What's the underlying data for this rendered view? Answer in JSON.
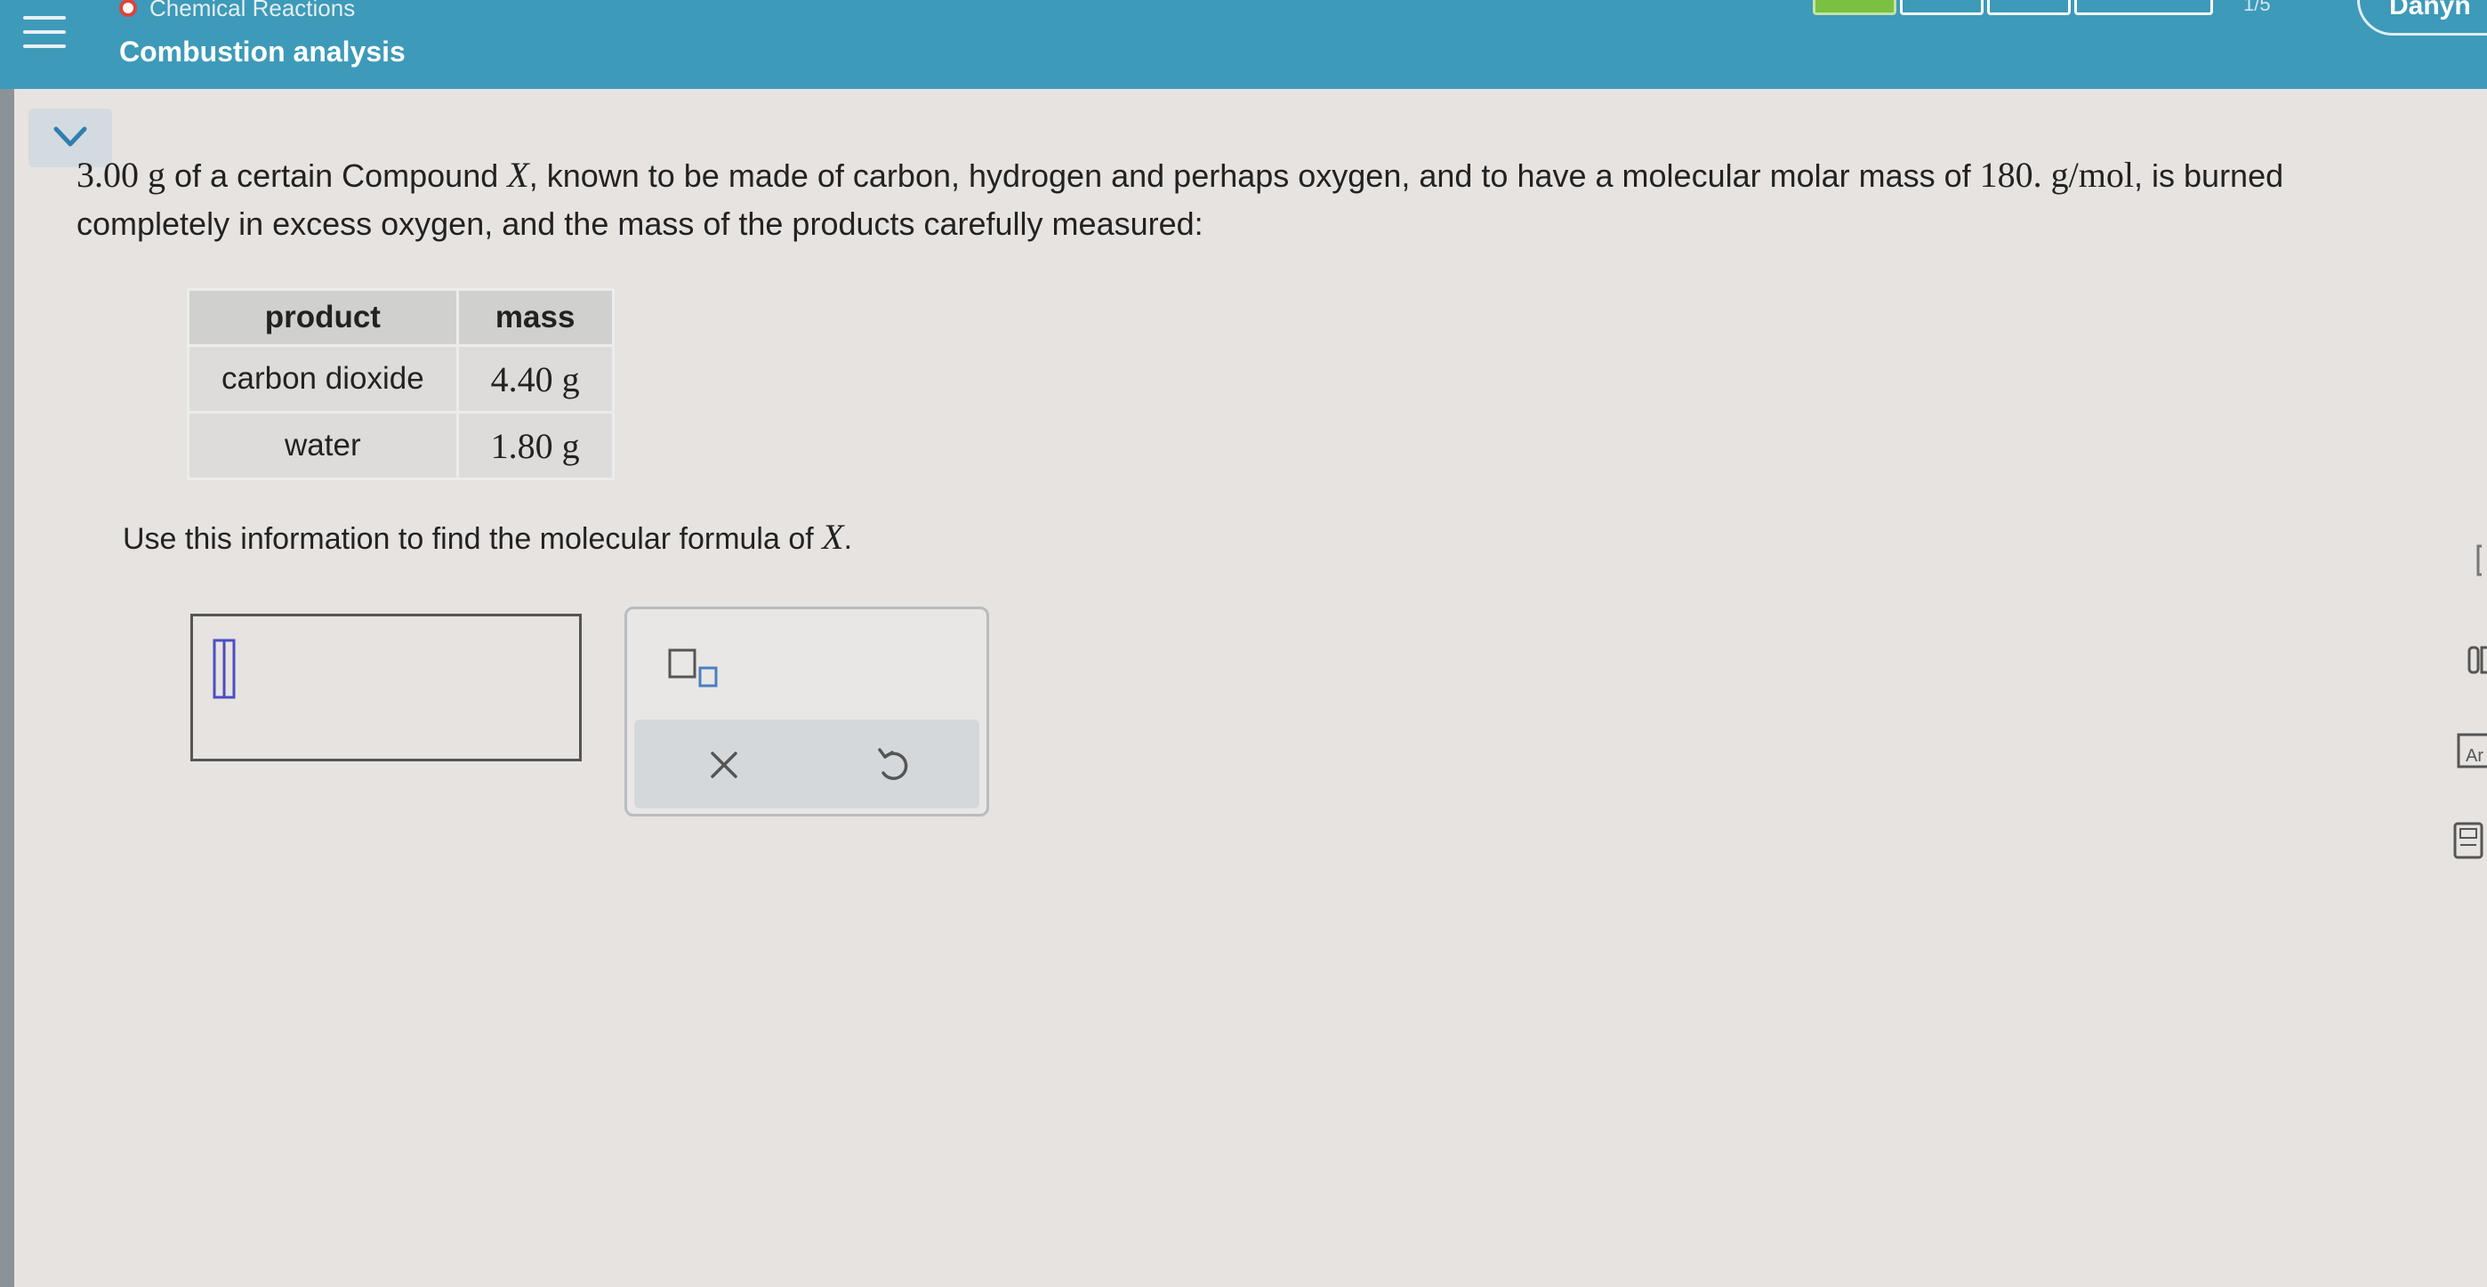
{
  "header": {
    "topic": "Chemical Reactions",
    "subtitle": "Combustion analysis",
    "progress_count": "1/5",
    "user_name": "Danyn"
  },
  "question": {
    "mass": "3.00",
    "unit_g": "g",
    "part1": " of a certain Compound ",
    "compound": "X",
    "part2": ", known to be made of carbon, hydrogen and perhaps oxygen, and to have a molecular molar mass of ",
    "molar_mass": "180.",
    "molar_unit": "g/mol",
    "part3": ", is burned completely in excess oxygen, and the mass of the products carefully measured:"
  },
  "table": {
    "headers": [
      "product",
      "mass"
    ],
    "rows": [
      {
        "product": "carbon dioxide",
        "mass": "4.40 g"
      },
      {
        "product": "water",
        "mass": "1.80 g"
      }
    ]
  },
  "instruction": {
    "text": "Use this information to find the molecular formula of ",
    "var": "X",
    "end": "."
  },
  "tools": {
    "clear_symbol": "×",
    "undo_symbol": "↺"
  },
  "colors": {
    "header": "#3d9ab9",
    "panel": "#e6e3e0",
    "accent_icon": "#4a4fc4",
    "progress_done": "#7ac142"
  },
  "icons": {
    "menu": "hamburger-icon",
    "collapse": "chevron-down-icon",
    "cursor": "text-cursor-icon",
    "subscript": "subscript-template-icon",
    "clear": "close-icon",
    "undo": "undo-icon",
    "side": [
      "bracket-icon",
      "data-icon",
      "periodic-table-icon",
      "calculator-icon"
    ]
  }
}
